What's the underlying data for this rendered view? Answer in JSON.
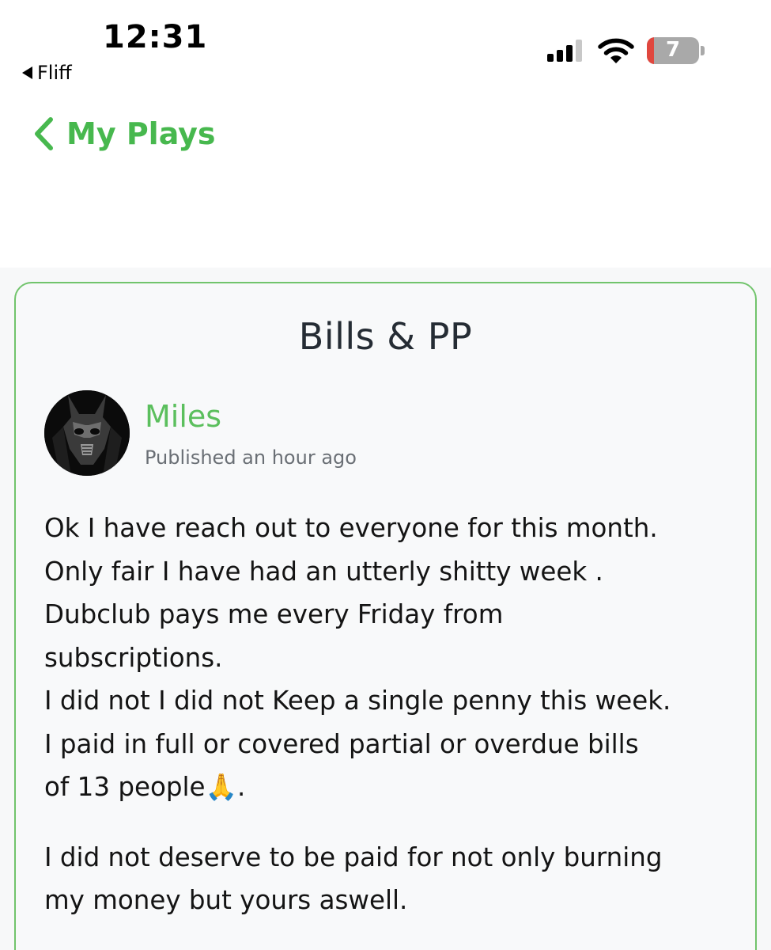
{
  "status_bar": {
    "time": "12:31",
    "back_app": "Fliff",
    "battery_level": "7"
  },
  "nav": {
    "back_label": "My Plays"
  },
  "post": {
    "title": "Bills & PP",
    "author": "Miles",
    "published": "Published an hour ago",
    "paragraphs": [
      "Ok I have reach out to everyone for this month.\nOnly fair I have had an utterly shitty week .\nDubclub pays me every Friday from\nsubscriptions.\nI did not I did not Keep a single penny this week.\nI paid in full or covered partial or overdue bills\nof 13 people🙏.",
      "I did not deserve to be paid for not only burning\nmy money but yours aswell."
    ]
  },
  "colors": {
    "accent_green": "#47b84e",
    "card_border": "#71c46c",
    "battery_low": "#e0473e"
  },
  "icons": {
    "back": "chevron-left-icon",
    "signal": "cellular-signal-icon",
    "wifi": "wifi-icon",
    "battery": "battery-icon"
  }
}
